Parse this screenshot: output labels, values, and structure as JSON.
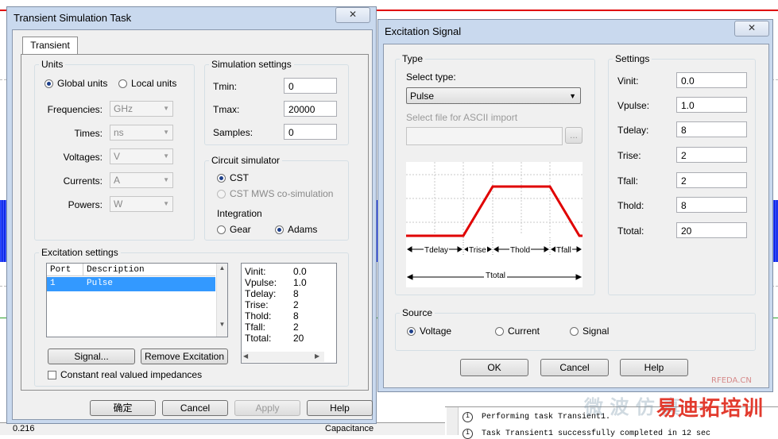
{
  "background": {
    "status_value": "0.216",
    "status_label": "Capacitance",
    "log_lines": [
      "Performing task Transient1.",
      "Task Transient1 successfully completed in 12 sec"
    ]
  },
  "transient_dialog": {
    "title": "Transient Simulation Task",
    "close_glyph": "✕",
    "tab": "Transient",
    "units": {
      "label": "Units",
      "global": "Global units",
      "local": "Local units",
      "rows": [
        {
          "label": "Frequencies:",
          "value": "GHz"
        },
        {
          "label": "Times:",
          "value": "ns"
        },
        {
          "label": "Voltages:",
          "value": "V"
        },
        {
          "label": "Currents:",
          "value": "A"
        },
        {
          "label": "Powers:",
          "value": "W"
        }
      ]
    },
    "simulation_settings": {
      "label": "Simulation settings",
      "tmin_label": "Tmin:",
      "tmin": "0",
      "tmax_label": "Tmax:",
      "tmax": "20000",
      "samples_label": "Samples:",
      "samples": "0"
    },
    "circuit_simulator": {
      "label": "Circuit simulator",
      "cst": "CST",
      "cst_mws": "CST MWS co-simulation",
      "integration_label": "Integration",
      "gear": "Gear",
      "adams": "Adams"
    },
    "excitation": {
      "label": "Excitation settings",
      "col_port": "Port",
      "col_desc": "Description",
      "row_port": "1",
      "row_desc": "Pulse",
      "params": [
        {
          "k": "Vinit:",
          "v": "0.0"
        },
        {
          "k": "Vpulse:",
          "v": "1.0"
        },
        {
          "k": "Tdelay:",
          "v": "8"
        },
        {
          "k": "Trise:",
          "v": "2"
        },
        {
          "k": "Thold:",
          "v": "8"
        },
        {
          "k": "Tfall:",
          "v": "2"
        },
        {
          "k": "Ttotal:",
          "v": "20"
        }
      ],
      "signal_btn": "Signal...",
      "remove_btn": "Remove Excitation",
      "constant_chk": "Constant real valued impedances"
    },
    "buttons": {
      "ok": "确定",
      "cancel": "Cancel",
      "apply": "Apply",
      "help": "Help"
    }
  },
  "excitation_dialog": {
    "title": "Excitation Signal",
    "type": {
      "label": "Type",
      "select_type": "Select type:",
      "type_value": "Pulse",
      "file_label": "Select file for ASCII import",
      "browse": "..."
    },
    "diagram": {
      "tdelay": "Tdelay",
      "trise": "Trise",
      "thold": "Thold",
      "tfall": "Tfall",
      "ttotal": "Ttotal",
      "line_color": "#e00000"
    },
    "settings": {
      "label": "Settings",
      "rows": [
        {
          "label": "Vinit:",
          "value": "0.0"
        },
        {
          "label": "Vpulse:",
          "value": "1.0"
        },
        {
          "label": "Tdelay:",
          "value": "8"
        },
        {
          "label": "Trise:",
          "value": "2"
        },
        {
          "label": "Tfall:",
          "value": "2"
        },
        {
          "label": "Thold:",
          "value": "8"
        },
        {
          "label": "Ttotal:",
          "value": "20"
        }
      ]
    },
    "source": {
      "label": "Source",
      "voltage": "Voltage",
      "current": "Current",
      "signal": "Signal"
    },
    "buttons": {
      "ok": "OK",
      "cancel": "Cancel",
      "help": "Help"
    }
  },
  "watermark": {
    "site": "RFEDA.CN",
    "brand": "易迪拓培训",
    "faint": "微 波 仿 真"
  }
}
